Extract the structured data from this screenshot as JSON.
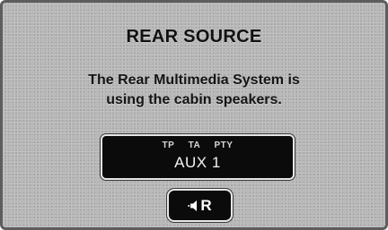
{
  "screen": {
    "title": "REAR SOURCE",
    "message_line1": "The Rear Multimedia System is",
    "message_line2": "using the cabin speakers."
  },
  "source_display": {
    "indicators": [
      "TP",
      "TA",
      "PTY"
    ],
    "source": "AUX 1"
  },
  "rear_button": {
    "icon": "speaker-icon",
    "label": "R"
  }
}
